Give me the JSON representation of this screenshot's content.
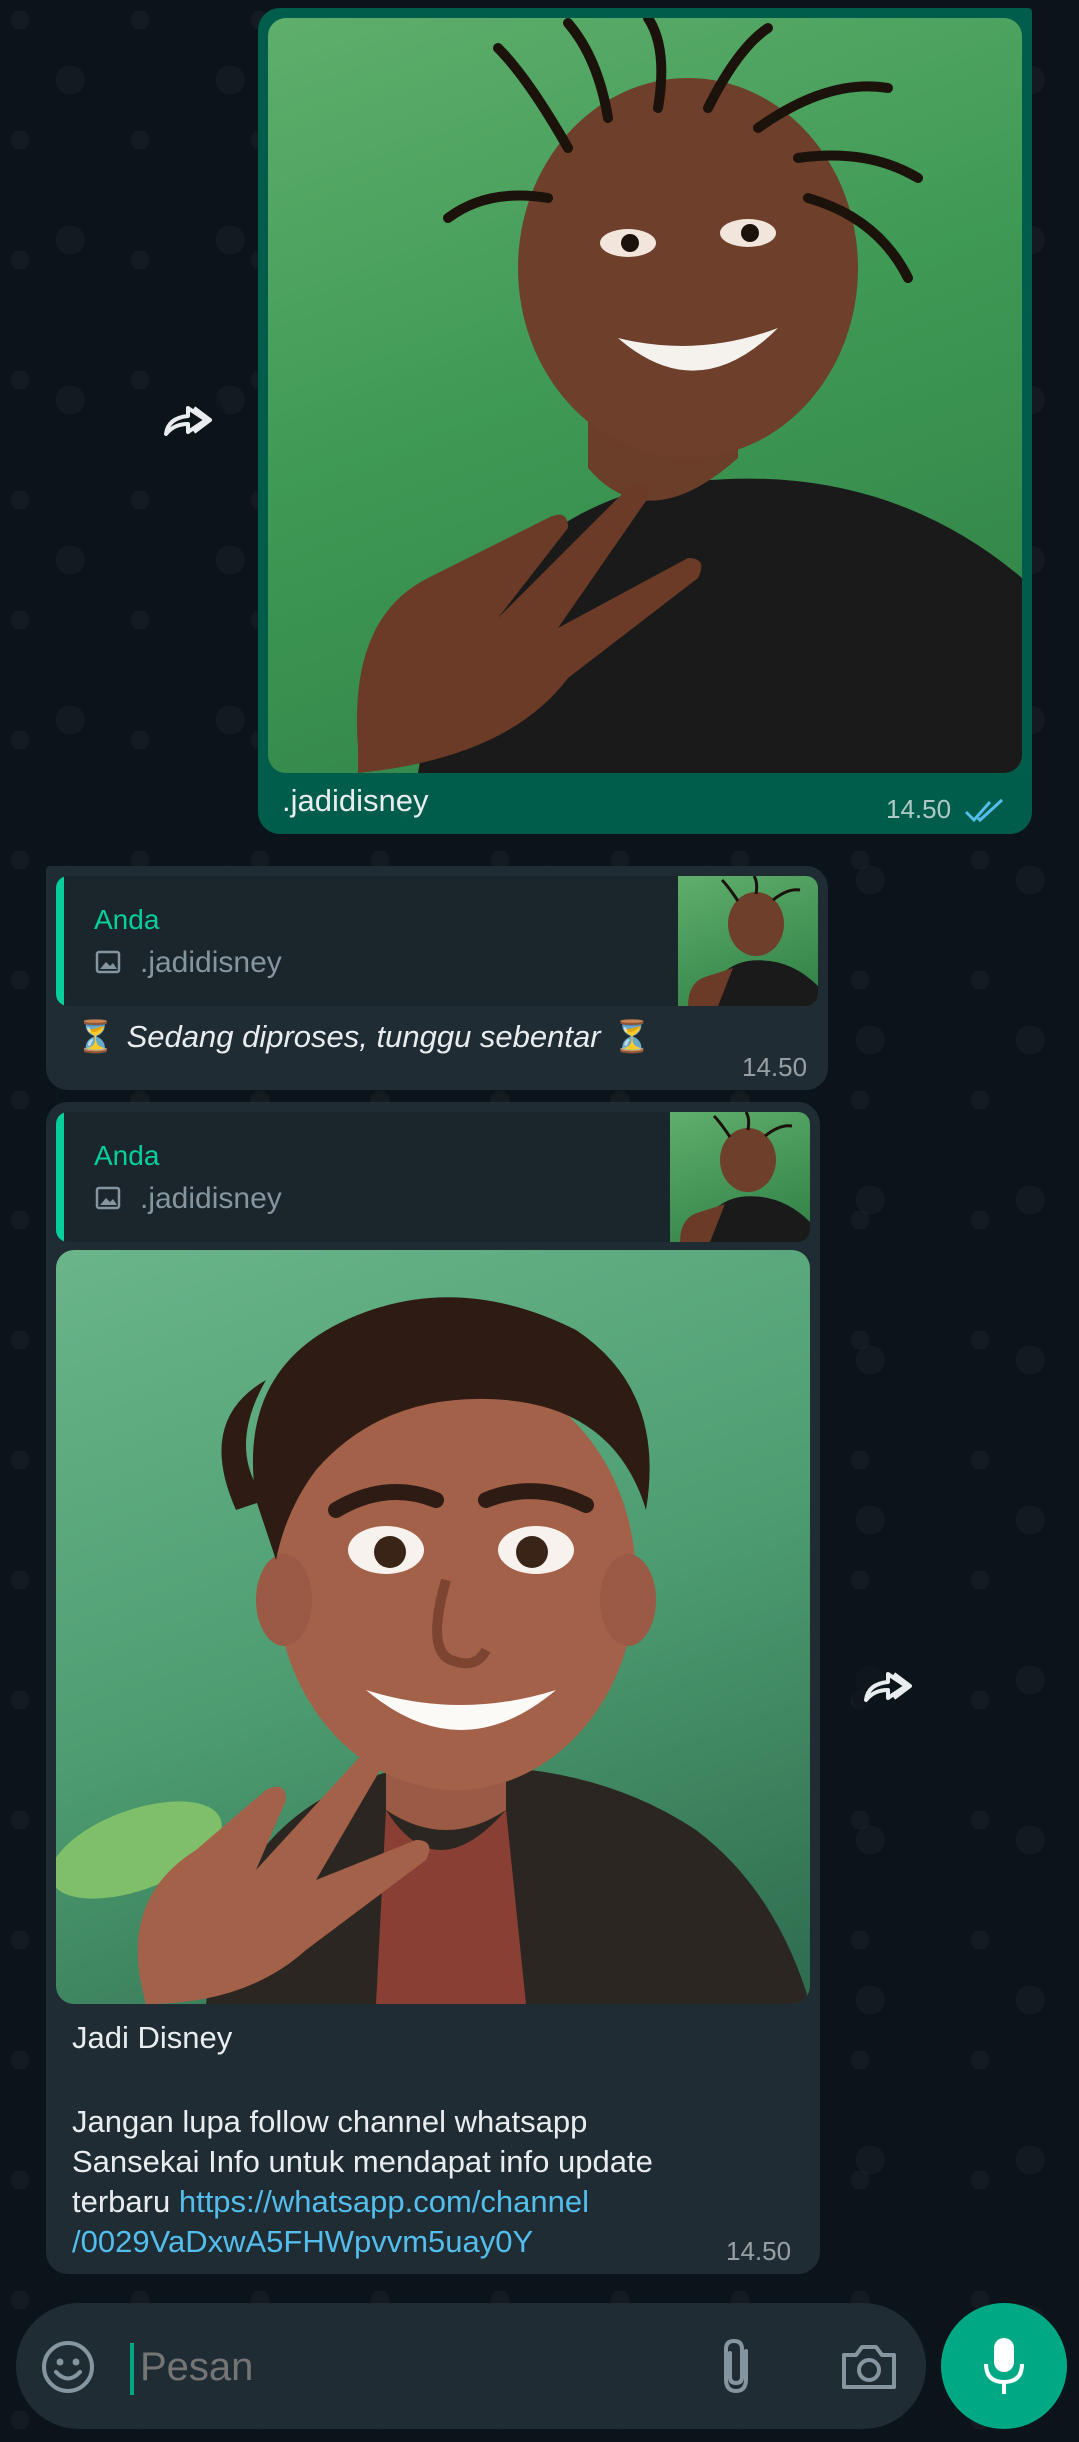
{
  "messages": [
    {
      "caption": ".jadidisney",
      "time": "14.50"
    },
    {
      "quote_author": "Anda",
      "quote_text": ".jadidisney",
      "text": "Sedang diproses, tunggu sebentar",
      "emoji": "⏳",
      "time": "14.50"
    },
    {
      "quote_author": "Anda",
      "quote_text": ".jadidisney",
      "title": "Jadi Disney",
      "body": "Jangan lupa follow channel whatsapp\nSansekai Info untuk mendapat info update\nterbaru ",
      "link_line1": "https://whatsapp.com/channel",
      "link_line2": "/0029VaDxwA5FHWpvvm5uay0Y",
      "time": "14.50"
    }
  ],
  "composer": {
    "placeholder": "Pesan"
  },
  "colors": {
    "outgoing_bubble": "#005c4b",
    "incoming_bubble": "#1f2c34",
    "accent": "#00a884",
    "quote_name": "#06cf9c",
    "link": "#53bdeb",
    "read_ticks": "#53bdeb"
  },
  "icons": [
    "forward-icon",
    "image-icon",
    "emoji-icon",
    "attach-icon",
    "camera-icon",
    "mic-icon",
    "double-check-icon"
  ]
}
